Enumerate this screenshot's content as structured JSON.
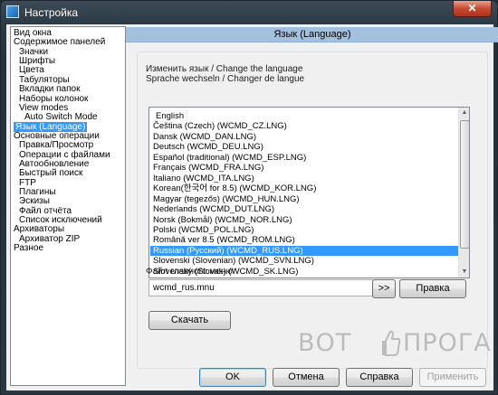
{
  "window": {
    "title": "Настройка",
    "close_glyph": "✕"
  },
  "sidebar": {
    "items": [
      {
        "label": "Вид окна",
        "indent": 0
      },
      {
        "label": "Содержимое панелей",
        "indent": 0
      },
      {
        "label": "Значки",
        "indent": 1
      },
      {
        "label": "Шрифты",
        "indent": 1
      },
      {
        "label": "Цвета",
        "indent": 1
      },
      {
        "label": "Табуляторы",
        "indent": 1
      },
      {
        "label": "Вкладки папок",
        "indent": 1
      },
      {
        "label": "Наборы колонок",
        "indent": 1
      },
      {
        "label": "View modes",
        "indent": 1
      },
      {
        "label": "Auto Switch Mode",
        "indent": 2
      },
      {
        "label": "Язык (Language)",
        "indent": 0,
        "selected": true
      },
      {
        "label": "Основные операции",
        "indent": 0
      },
      {
        "label": "Правка/Просмотр",
        "indent": 1
      },
      {
        "label": "Операции с файлами",
        "indent": 1
      },
      {
        "label": "Автообновление",
        "indent": 1
      },
      {
        "label": "Быстрый поиск",
        "indent": 1
      },
      {
        "label": "FTP",
        "indent": 1
      },
      {
        "label": "Плагины",
        "indent": 1
      },
      {
        "label": "Эскизы",
        "indent": 1
      },
      {
        "label": "Файл отчёта",
        "indent": 1
      },
      {
        "label": "Список исключений",
        "indent": 1
      },
      {
        "label": "Архиваторы",
        "indent": 0
      },
      {
        "label": "Архиватор ZIP",
        "indent": 1
      },
      {
        "label": "Разное",
        "indent": 0
      }
    ]
  },
  "panel": {
    "header": "Язык (Language)",
    "caption_line1": "Изменить язык / Change the language",
    "caption_line2": "Sprache wechseln / Changer de langue",
    "languages": [
      "English",
      "Čeština (Czech) (WCMD_CZ.LNG)",
      "Dansk (WCMD_DAN.LNG)",
      "Deutsch (WCMD_DEU.LNG)",
      "Español (traditional) (WCMD_ESP.LNG)",
      "Français (WCMD_FRA.LNG)",
      "Italiano (WCMD_ITA.LNG)",
      "Korean(한국어 for 8.5) (WCMD_KOR.LNG)",
      "Magyar (tegezős) (WCMD_HUN.LNG)",
      "Nederlands (WCMD_DUT.LNG)",
      "Norsk (Bokmål) (WCMD_NOR.LNG)",
      "Polski (WCMD_POL.LNG)",
      "Română ver 8.5 (WCMD_ROM.LNG)",
      "Russian (Русский) (WCMD_RUS.LNG)",
      "Slovenski (Slovenian) (WCMD_SVN.LNG)",
      "Slovenský (Slovak) (WCMD_SK.LNG)"
    ],
    "selected_index": 13,
    "menu_file_label": "Файл главного меню:",
    "menu_file_value": "wcmd_rus.mnu",
    "browse_button": ">>",
    "edit_button": "Правка",
    "download_button": "Скачать"
  },
  "footer": {
    "ok": "OK",
    "cancel": "Отмена",
    "help": "Справка",
    "apply": "Применить"
  },
  "watermark": {
    "left": "ВОТ",
    "right": "ПРОГА"
  }
}
